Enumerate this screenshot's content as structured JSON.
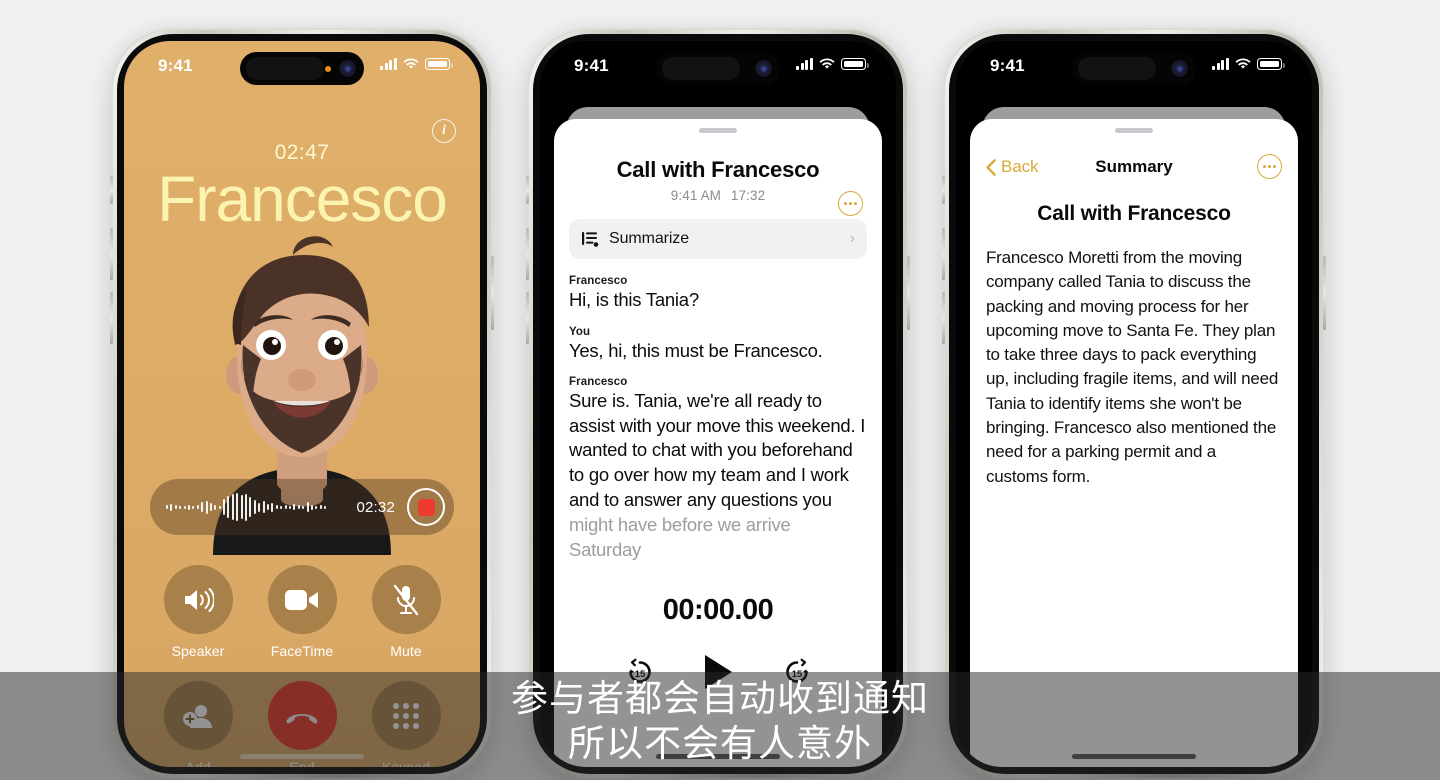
{
  "canvas": {
    "background": "#f1f1f2"
  },
  "subtitle": {
    "line1": "参与者都会自动收到通知",
    "line2": "所以不会有人意外"
  },
  "phone1": {
    "name": "call-screen",
    "status": {
      "time": "9:41",
      "signal_icon": "cellular-bars-icon",
      "wifi_icon": "wifi-icon",
      "battery_icon": "battery-icon"
    },
    "island": {
      "recording_dot": "recording-indicator-dot",
      "camera": "front-camera"
    },
    "info_button": "i",
    "call_timer": "02:47",
    "caller_name": "Francesco",
    "avatar": "memoji-avatar",
    "recorder": {
      "time": "02:32",
      "stop_label": "stop-recording"
    },
    "controls": [
      {
        "label": "Speaker",
        "icon": "speaker-icon",
        "state": "active"
      },
      {
        "label": "FaceTime",
        "icon": "video-camera-icon",
        "state": "active"
      },
      {
        "label": "Mute",
        "icon": "microphone-muted-icon",
        "state": "active"
      },
      {
        "label": "Add",
        "icon": "add-person-icon",
        "state": "active"
      },
      {
        "label": "End",
        "icon": "end-call-icon",
        "state": "destructive"
      },
      {
        "label": "Keypad",
        "icon": "keypad-icon",
        "state": "active"
      }
    ],
    "colors": {
      "background": "#dcab66",
      "name_text": "#fbf3b0",
      "end_button": "#e8342a"
    }
  },
  "phone2": {
    "name": "transcript-sheet",
    "status": {
      "time": "9:41"
    },
    "sheet_title": "Call with Francesco",
    "sheet_time": "9:41 AM",
    "sheet_duration": "17:32",
    "more_button": "more-options",
    "summarize": {
      "label": "Summarize",
      "icon": "summarize-lines-icon",
      "chevron": "›"
    },
    "transcript": [
      {
        "speaker": "Francesco",
        "text": "Hi, is this Tania?",
        "faded": false
      },
      {
        "speaker": "You",
        "text": "Yes, hi, this must be Francesco.",
        "faded": false
      },
      {
        "speaker": "Francesco",
        "text": "Sure is. Tania, we're all ready to assist with your move this weekend. I wanted to chat with you beforehand to go over how my team and I work and to answer any questions you",
        "faded": false
      },
      {
        "speaker": "",
        "text": "might have before we arrive Saturday",
        "faded": true
      }
    ],
    "player": {
      "elapsed": "00:00.00",
      "back_label": "15",
      "forward_label": "15",
      "play_icon": "play-icon"
    }
  },
  "phone3": {
    "name": "summary-screen",
    "status": {
      "time": "9:41"
    },
    "nav": {
      "back_label": "Back",
      "title": "Summary",
      "more_button": "more-options"
    },
    "summary_title": "Call with Francesco",
    "summary_body": "Francesco Moretti from the moving company called Tania to discuss the packing and moving process for her upcoming move to Santa Fe. They plan to take three days to pack everything up, including fragile items, and will need Tania to identify items she won't be bringing. Francesco also mentioned the need for a parking permit and a customs form."
  }
}
